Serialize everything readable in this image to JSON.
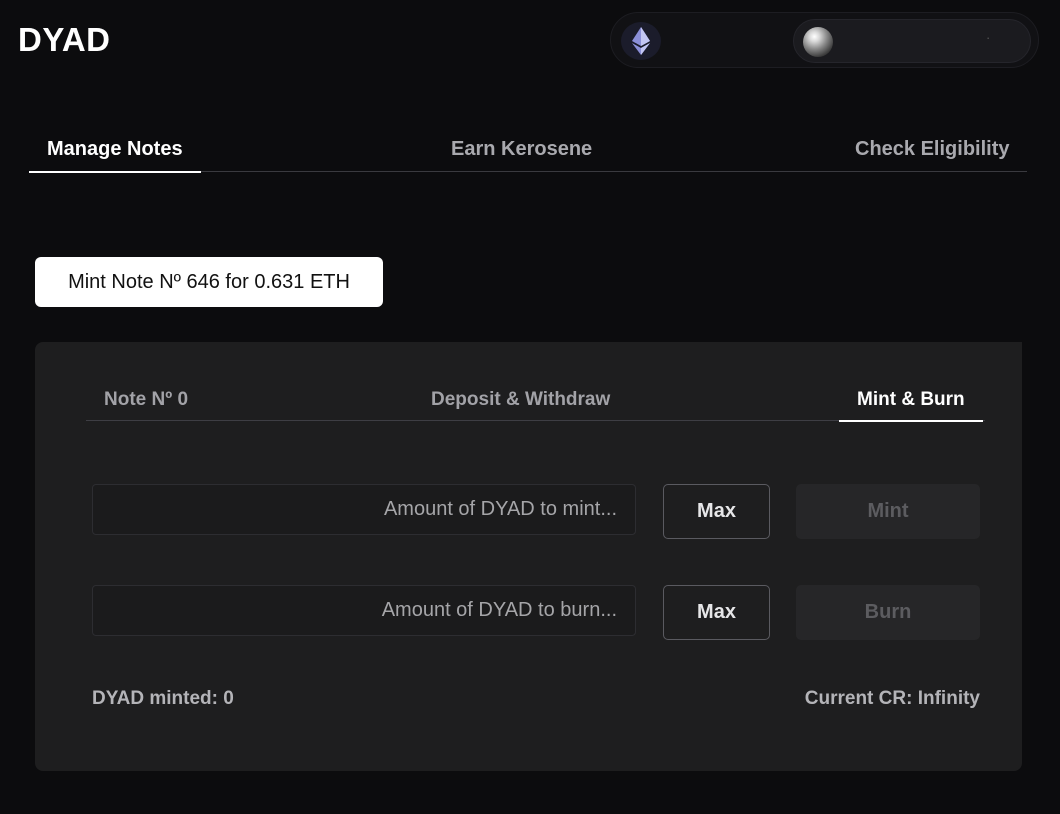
{
  "header": {
    "logo": "DYAD",
    "network_icon": "ethereum-icon",
    "account_label": "·"
  },
  "main_tabs": [
    {
      "label": "Manage Notes",
      "active": true
    },
    {
      "label": "Earn Kerosene",
      "active": false
    },
    {
      "label": "Check Eligibility",
      "active": false
    }
  ],
  "mint_note_button": "Mint Note Nº 646 for 0.631 ETH",
  "card": {
    "tabs": [
      {
        "label": "Note Nº 0",
        "active": false
      },
      {
        "label": "Deposit & Withdraw",
        "active": false
      },
      {
        "label": "Mint & Burn",
        "active": true
      }
    ],
    "mint_input": {
      "placeholder": "Amount of DYAD to mint...",
      "value": ""
    },
    "burn_input": {
      "placeholder": "Amount of DYAD to burn...",
      "value": ""
    },
    "max_label": "Max",
    "mint_label": "Mint",
    "burn_label": "Burn",
    "dyad_minted_label": "DYAD minted:",
    "dyad_minted_value": "0",
    "current_cr_label": "Current CR:",
    "current_cr_value": "Infinity"
  },
  "colors": {
    "background": "#0c0c0e",
    "card": "#1e1e1f",
    "active_text": "#ffffff",
    "inactive_text": "#a9a9ae",
    "disabled_button": "#262628"
  }
}
